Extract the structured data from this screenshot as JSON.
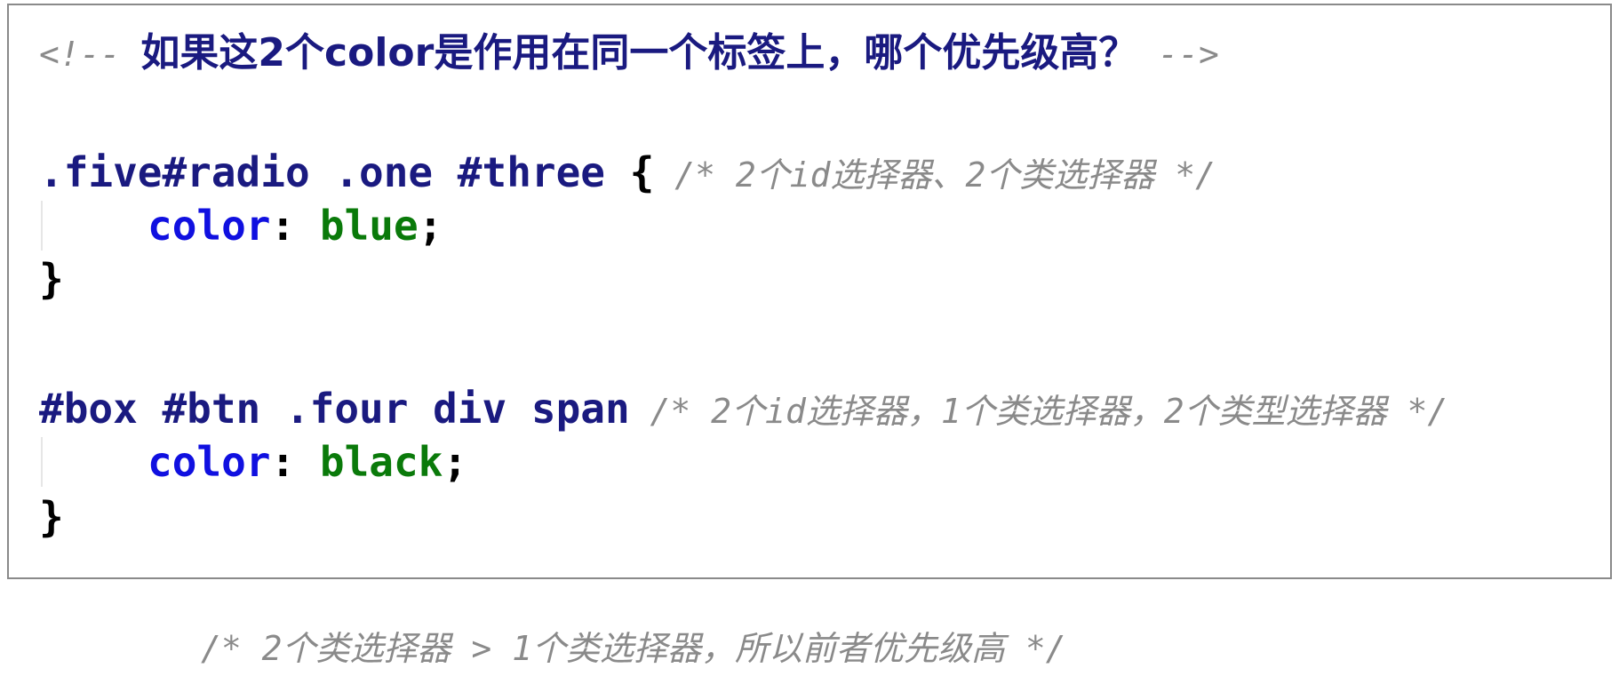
{
  "heading": {
    "open": "<!-- ",
    "title": "如果这2个color是作用在同一个标签上，哪个优先级高？",
    "close": " -->"
  },
  "rule1": {
    "selector": ".five#radio .one #three",
    "brace_open": " {",
    "comment": " /* 2个id选择器、2个类选择器 */",
    "property": "color",
    "colon": ": ",
    "value": "blue",
    "semicolon": ";",
    "brace_close": "}"
  },
  "rule2": {
    "selector": "#box #btn .four div span",
    "comment": " /* 2个id选择器，1个类选择器，2个类型选择器 */",
    "property": "color",
    "colon": ": ",
    "value": "black",
    "semicolon": ";",
    "brace_close": "}"
  },
  "footer": {
    "text": "/* 2个类选择器 > 1个类选择器，所以前者优先级高 */"
  },
  "colors": {
    "selector": "#1a1a80",
    "property": "#1010e0",
    "value": "#0a7a0a",
    "comment": "#8a8a8a",
    "border": "#8a8a8a"
  }
}
